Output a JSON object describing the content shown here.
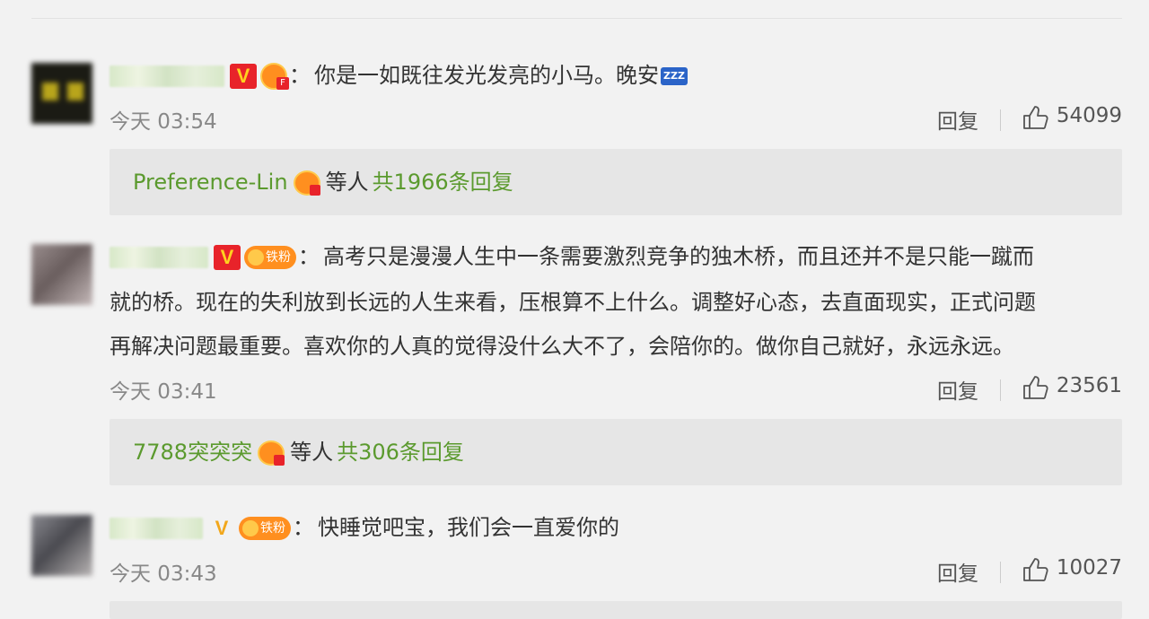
{
  "comments": [
    {
      "text": "你是一如既往发光发亮的小马。晚安",
      "emoji": "zzz-emoji",
      "time": "今天 03:54",
      "reply_label": "回复",
      "likes": "54099",
      "replies": {
        "who": "Preference-Lin",
        "mid": "等人",
        "count": "共1966条回复"
      }
    },
    {
      "fan_badge": "铁粉",
      "text_lines": [
        "高考只是漫漫人生中一条需要激烈竞争的独木桥，而且还并不是只能一蹴而",
        "就的桥。现在的失利放到长远的人生来看，压根算不上什么。调整好心态，去直面现实，正式问题",
        "再解决问题最重要。喜欢你的人真的觉得没什么大不了，会陪你的。做你自己就好，永远永远。"
      ],
      "time": "今天 03:41",
      "reply_label": "回复",
      "likes": "23561",
      "replies": {
        "who": "7788突突突",
        "mid": "等人",
        "count": "共306条回复"
      }
    },
    {
      "fan_badge": "铁粉",
      "text": "快睡觉吧宝，我们会一直爱你的",
      "time": "今天 03:43",
      "reply_label": "回复",
      "likes": "10027"
    }
  ],
  "colors": {
    "link_green": "#5b9a2e",
    "vip_red": "#e8232a",
    "fan_orange": "#ff8f1f"
  },
  "icons": [
    "thumbs-up-icon",
    "verified-v-icon",
    "fan-crown-icon"
  ]
}
